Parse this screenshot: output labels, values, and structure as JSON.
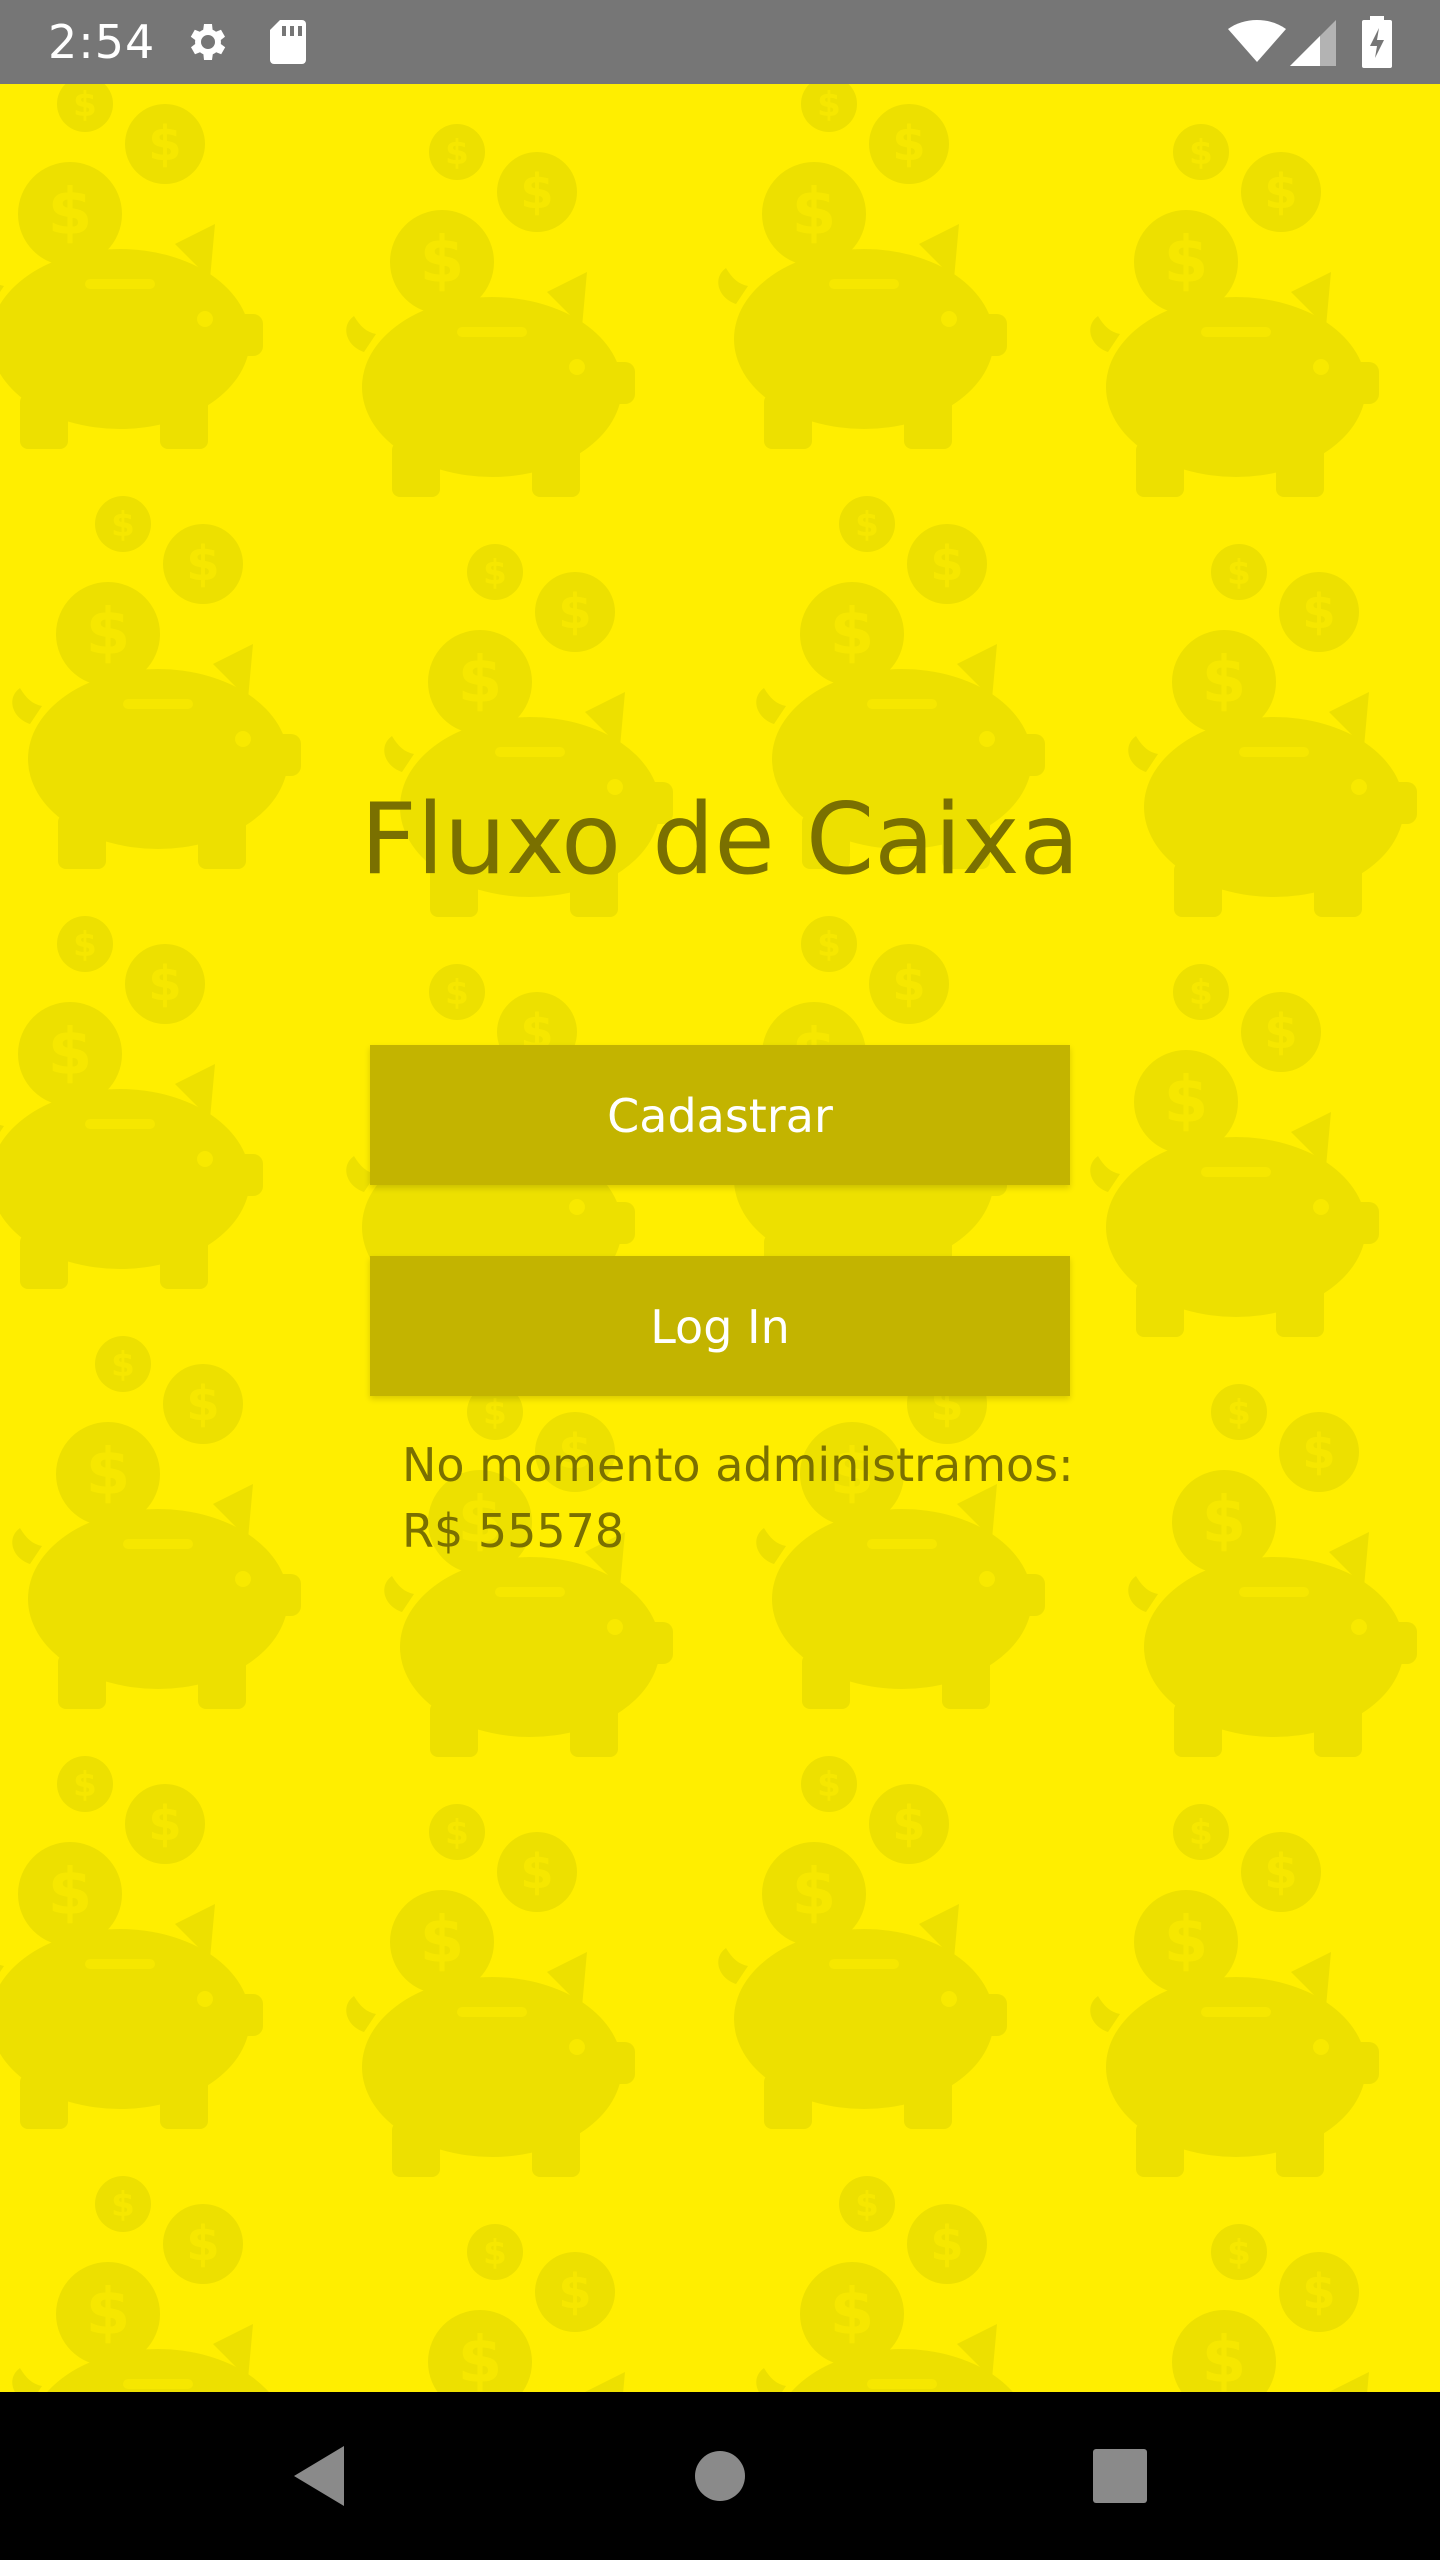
{
  "status_bar": {
    "time": "2:54",
    "icons": [
      "gear-icon",
      "sd-card-icon",
      "wifi-icon",
      "signal-icon",
      "battery-charging-icon"
    ]
  },
  "app": {
    "title": "Fluxo de Caixa",
    "register_label": "Cadastrar",
    "login_label": "Log In",
    "info_line1": "No momento administramos:",
    "info_line2": "R$ 55578"
  },
  "nav_bar": {
    "icons": [
      "back-icon",
      "home-icon",
      "recents-icon"
    ]
  },
  "colors": {
    "background": "#ffee00",
    "pattern": "#ede000",
    "button": "#c3b400",
    "text": "#7a7000",
    "status_bar": "#767676",
    "nav_bar": "#000000"
  }
}
